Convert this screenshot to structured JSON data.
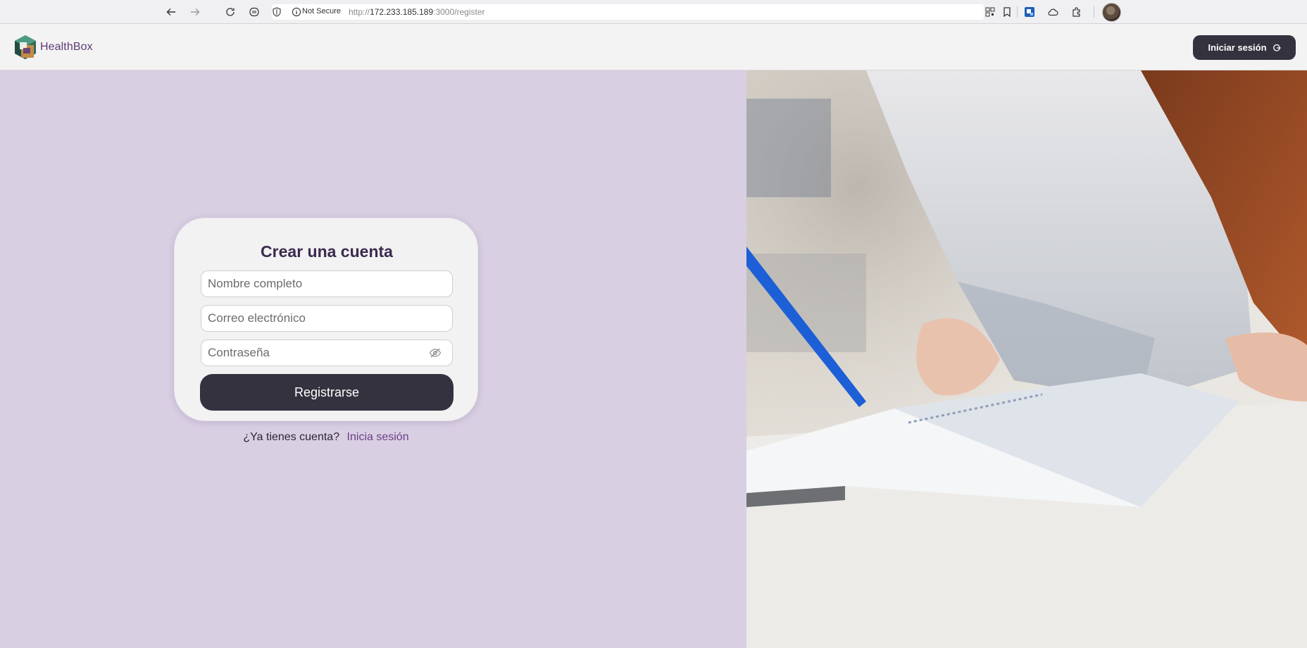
{
  "browser": {
    "security_label": "Not Secure",
    "url_protocol": "http://",
    "url_host": "172.233.185.189",
    "url_path": ":3000/register",
    "icons": [
      "back-arrow-icon",
      "forward-arrow-icon",
      "reload-icon",
      "reader-icon",
      "shield-icon",
      "info-icon",
      "qr-code-icon",
      "bookmark-icon",
      "extension-blue-icon",
      "cloud-icon",
      "puzzle-icon"
    ]
  },
  "header": {
    "brand_name": "HealthBox",
    "login_label": "Iniciar sesión"
  },
  "form": {
    "title": "Crear una cuenta",
    "name_placeholder": "Nombre completo",
    "email_placeholder": "Correo electrónico",
    "password_placeholder": "Contraseña",
    "submit_label": "Registrarse"
  },
  "footer": {
    "prompt": "¿Ya tienes cuenta?",
    "link_label": "Inicia sesión"
  },
  "colors": {
    "left_background": "#d9cfe3",
    "primary_button": "#34323f",
    "brand_purple": "#5e3c78",
    "link": "#6b3f86"
  }
}
